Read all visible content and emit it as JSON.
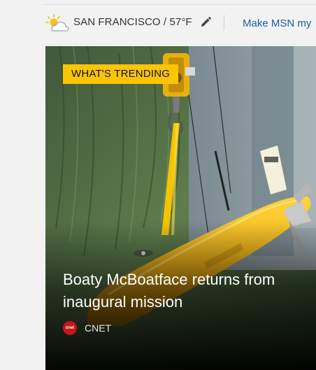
{
  "header": {
    "weather": {
      "icon": "partly-sunny-icon",
      "text": "SAN FRANCISCO / 57°F"
    },
    "edit_icon": "pencil-icon",
    "personalize_label": "Make MSN my"
  },
  "trending_card": {
    "badge": "WHAT'S TRENDING",
    "headline": "Boaty McBoatface returns from inaugural mission",
    "source": {
      "logo_text": "cnet",
      "name": "CNET"
    },
    "colors": {
      "badge": "#fbc505",
      "sub_hull": "#f2b417",
      "background_tarp": "#4e6a3b"
    }
  }
}
